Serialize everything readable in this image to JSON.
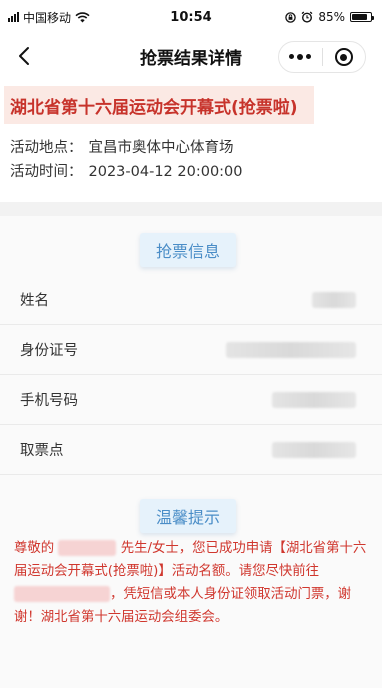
{
  "status_bar": {
    "carrier": "中国移动",
    "time": "10:54",
    "battery": "85%",
    "battery_level": 0.85
  },
  "nav": {
    "title": "抢票结果详情"
  },
  "event": {
    "title": "湖北省第十六届运动会开幕式(抢票啦)",
    "venue_label": "活动地点：",
    "venue": "宜昌市奥体中心体育场",
    "time_label": "活动时间：",
    "time": "2023-04-12 20:00:00"
  },
  "ticket_info": {
    "heading": "抢票信息",
    "rows": [
      {
        "label": "姓名"
      },
      {
        "label": "身份证号"
      },
      {
        "label": "手机号码"
      },
      {
        "label": "取票点"
      }
    ]
  },
  "notice": {
    "heading": "温馨提示",
    "part1": "尊敬的",
    "part2": "先生/女士，您已成功申请【湖北省第十六届运动会开幕式(抢票啦)】活动名额。请您尽快前往",
    "part3": "，凭短信或本人身份证领取活动门票，谢谢！湖北省第十六届运动会组委会。"
  },
  "colors": {
    "accent_red": "#c7332b",
    "title_bg": "#fbe9e4",
    "badge_bg": "#e6f2fb",
    "badge_text": "#4a8dc7",
    "notice_text": "#d0372e"
  },
  "icons": [
    "signal-icon",
    "wifi-icon",
    "lock-rotation-icon",
    "alarm-icon",
    "battery-icon",
    "back-arrow-icon",
    "more-dots-icon",
    "close-target-icon"
  ]
}
